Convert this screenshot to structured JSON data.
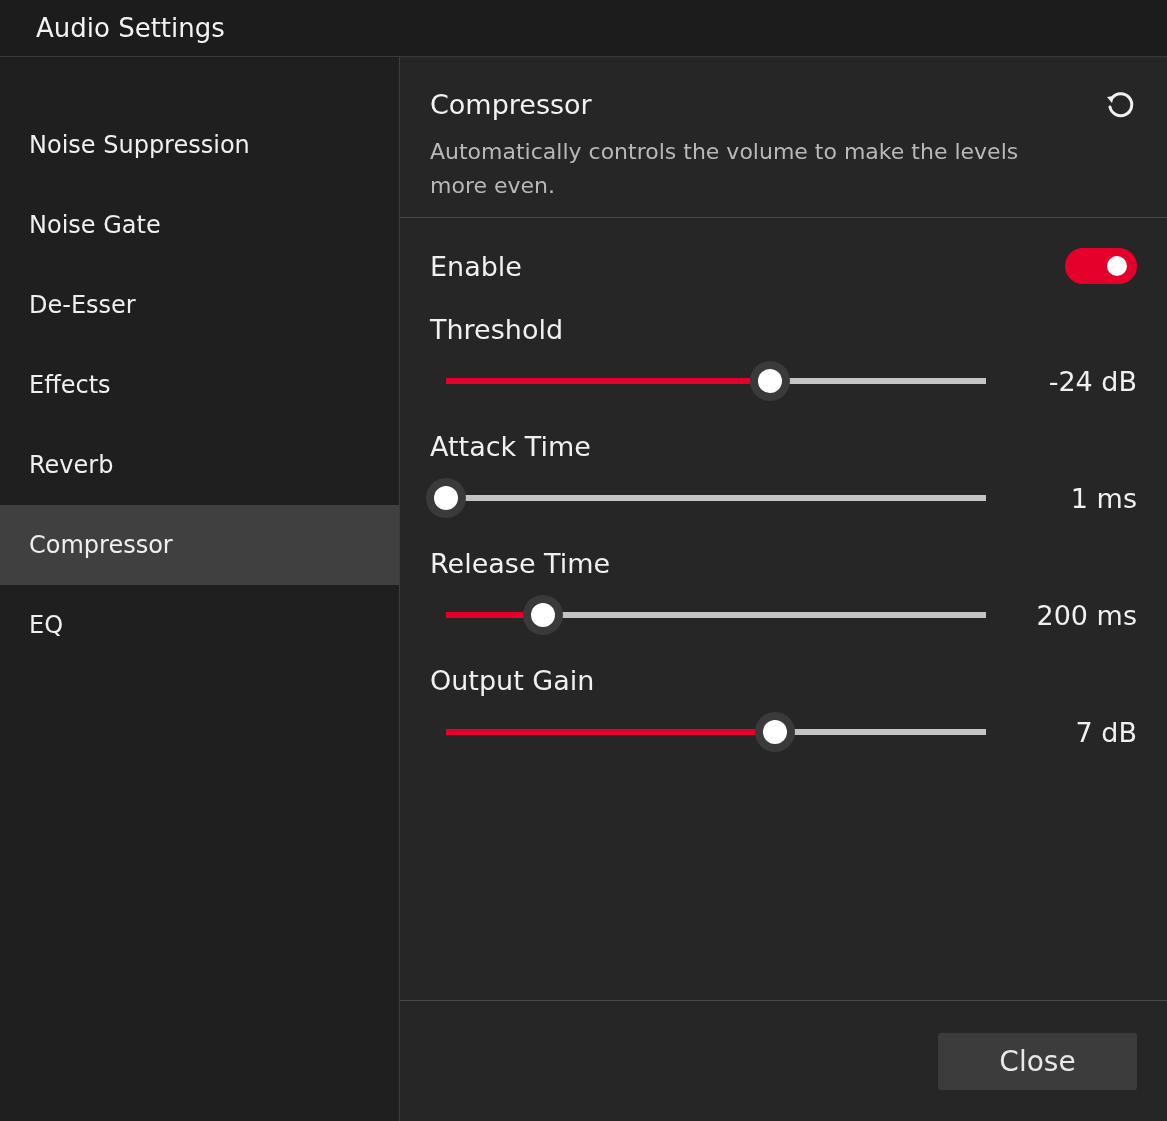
{
  "window": {
    "title": "Audio Settings"
  },
  "sidebar": {
    "items": [
      {
        "label": "Noise Suppression",
        "selected": false
      },
      {
        "label": "Noise Gate",
        "selected": false
      },
      {
        "label": "De-Esser",
        "selected": false
      },
      {
        "label": "Effects",
        "selected": false
      },
      {
        "label": "Reverb",
        "selected": false
      },
      {
        "label": "Compressor",
        "selected": true
      },
      {
        "label": "EQ",
        "selected": false
      }
    ]
  },
  "panel": {
    "title": "Compressor",
    "description": "Automatically controls the volume to make the levels more even.",
    "enable": {
      "label": "Enable",
      "on": true
    },
    "sliders": [
      {
        "label": "Threshold",
        "level": 0.6,
        "reading": "-24 dB"
      },
      {
        "label": "Attack Time",
        "level": 0.0,
        "reading": "1 ms"
      },
      {
        "label": "Release Time",
        "level": 0.18,
        "reading": "200 ms"
      },
      {
        "label": "Output Gain",
        "level": 0.61,
        "reading": "7 dB"
      }
    ]
  },
  "buttons": [
    "Close"
  ]
}
